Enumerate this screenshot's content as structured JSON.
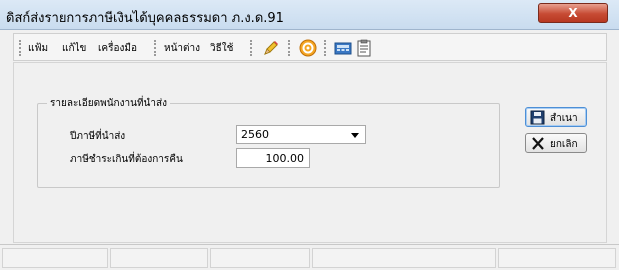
{
  "window": {
    "title": "ดิสก์ส่งรายการภาษีเงินได้บุคคลธรรมดา ภ.ง.ด.91",
    "close_label": "X"
  },
  "menu": {
    "items": [
      {
        "label": "แฟ้ม"
      },
      {
        "label": "แก้ไข"
      },
      {
        "label": "เครื่องมือ"
      },
      {
        "label": "หน้าต่าง"
      },
      {
        "label": "วิธีใช้"
      }
    ],
    "icons": [
      "pencil-icon",
      "target-icon",
      "calculator-icon",
      "notepad-icon"
    ]
  },
  "form": {
    "group_title": "รายละเอียดพนักงานที่นำส่ง",
    "tax_year_label": "ปีภาษีที่นำส่ง",
    "tax_year_value": "2560",
    "refund_label": "ภาษีชำระเกินที่ต้องการคืน",
    "refund_value": "100.00"
  },
  "buttons": {
    "save_label": "สำเนา",
    "cancel_label": "ยกเลิก"
  },
  "colors": {
    "title_bar": "#c9dcef",
    "close_button": "#c74b34",
    "primary_border": "#4d8fd6"
  }
}
